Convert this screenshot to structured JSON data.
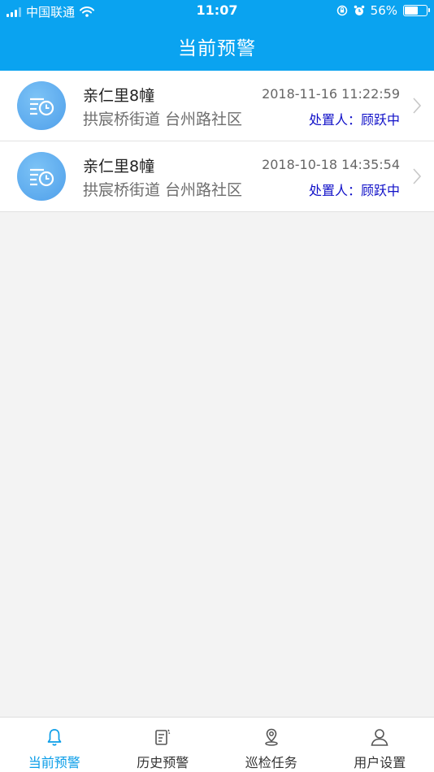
{
  "status_bar": {
    "carrier": "中国联通",
    "time": "11:07",
    "battery": "56%",
    "battery_level": 0.56
  },
  "header": {
    "title": "当前预警"
  },
  "alerts": [
    {
      "title": "亲仁里8幢",
      "address": "拱宸桥街道 台州路社区",
      "time": "2018-11-16 11:22:59",
      "handler": "处置人：顾跃中"
    },
    {
      "title": "亲仁里8幢",
      "address": "拱宸桥街道 台州路社区",
      "time": "2018-10-18 14:35:54",
      "handler": "处置人：顾跃中"
    }
  ],
  "tabs": [
    {
      "label": "当前预警",
      "icon": "bell-icon",
      "active": true
    },
    {
      "label": "历史预警",
      "icon": "history-doc-icon",
      "active": false
    },
    {
      "label": "巡检任务",
      "icon": "location-pin-icon",
      "active": false
    },
    {
      "label": "用户设置",
      "icon": "user-icon",
      "active": false
    }
  ],
  "colors": {
    "primary": "#0aa3f0",
    "active_tab": "#0a9de8",
    "handler_text": "#1010c8"
  }
}
